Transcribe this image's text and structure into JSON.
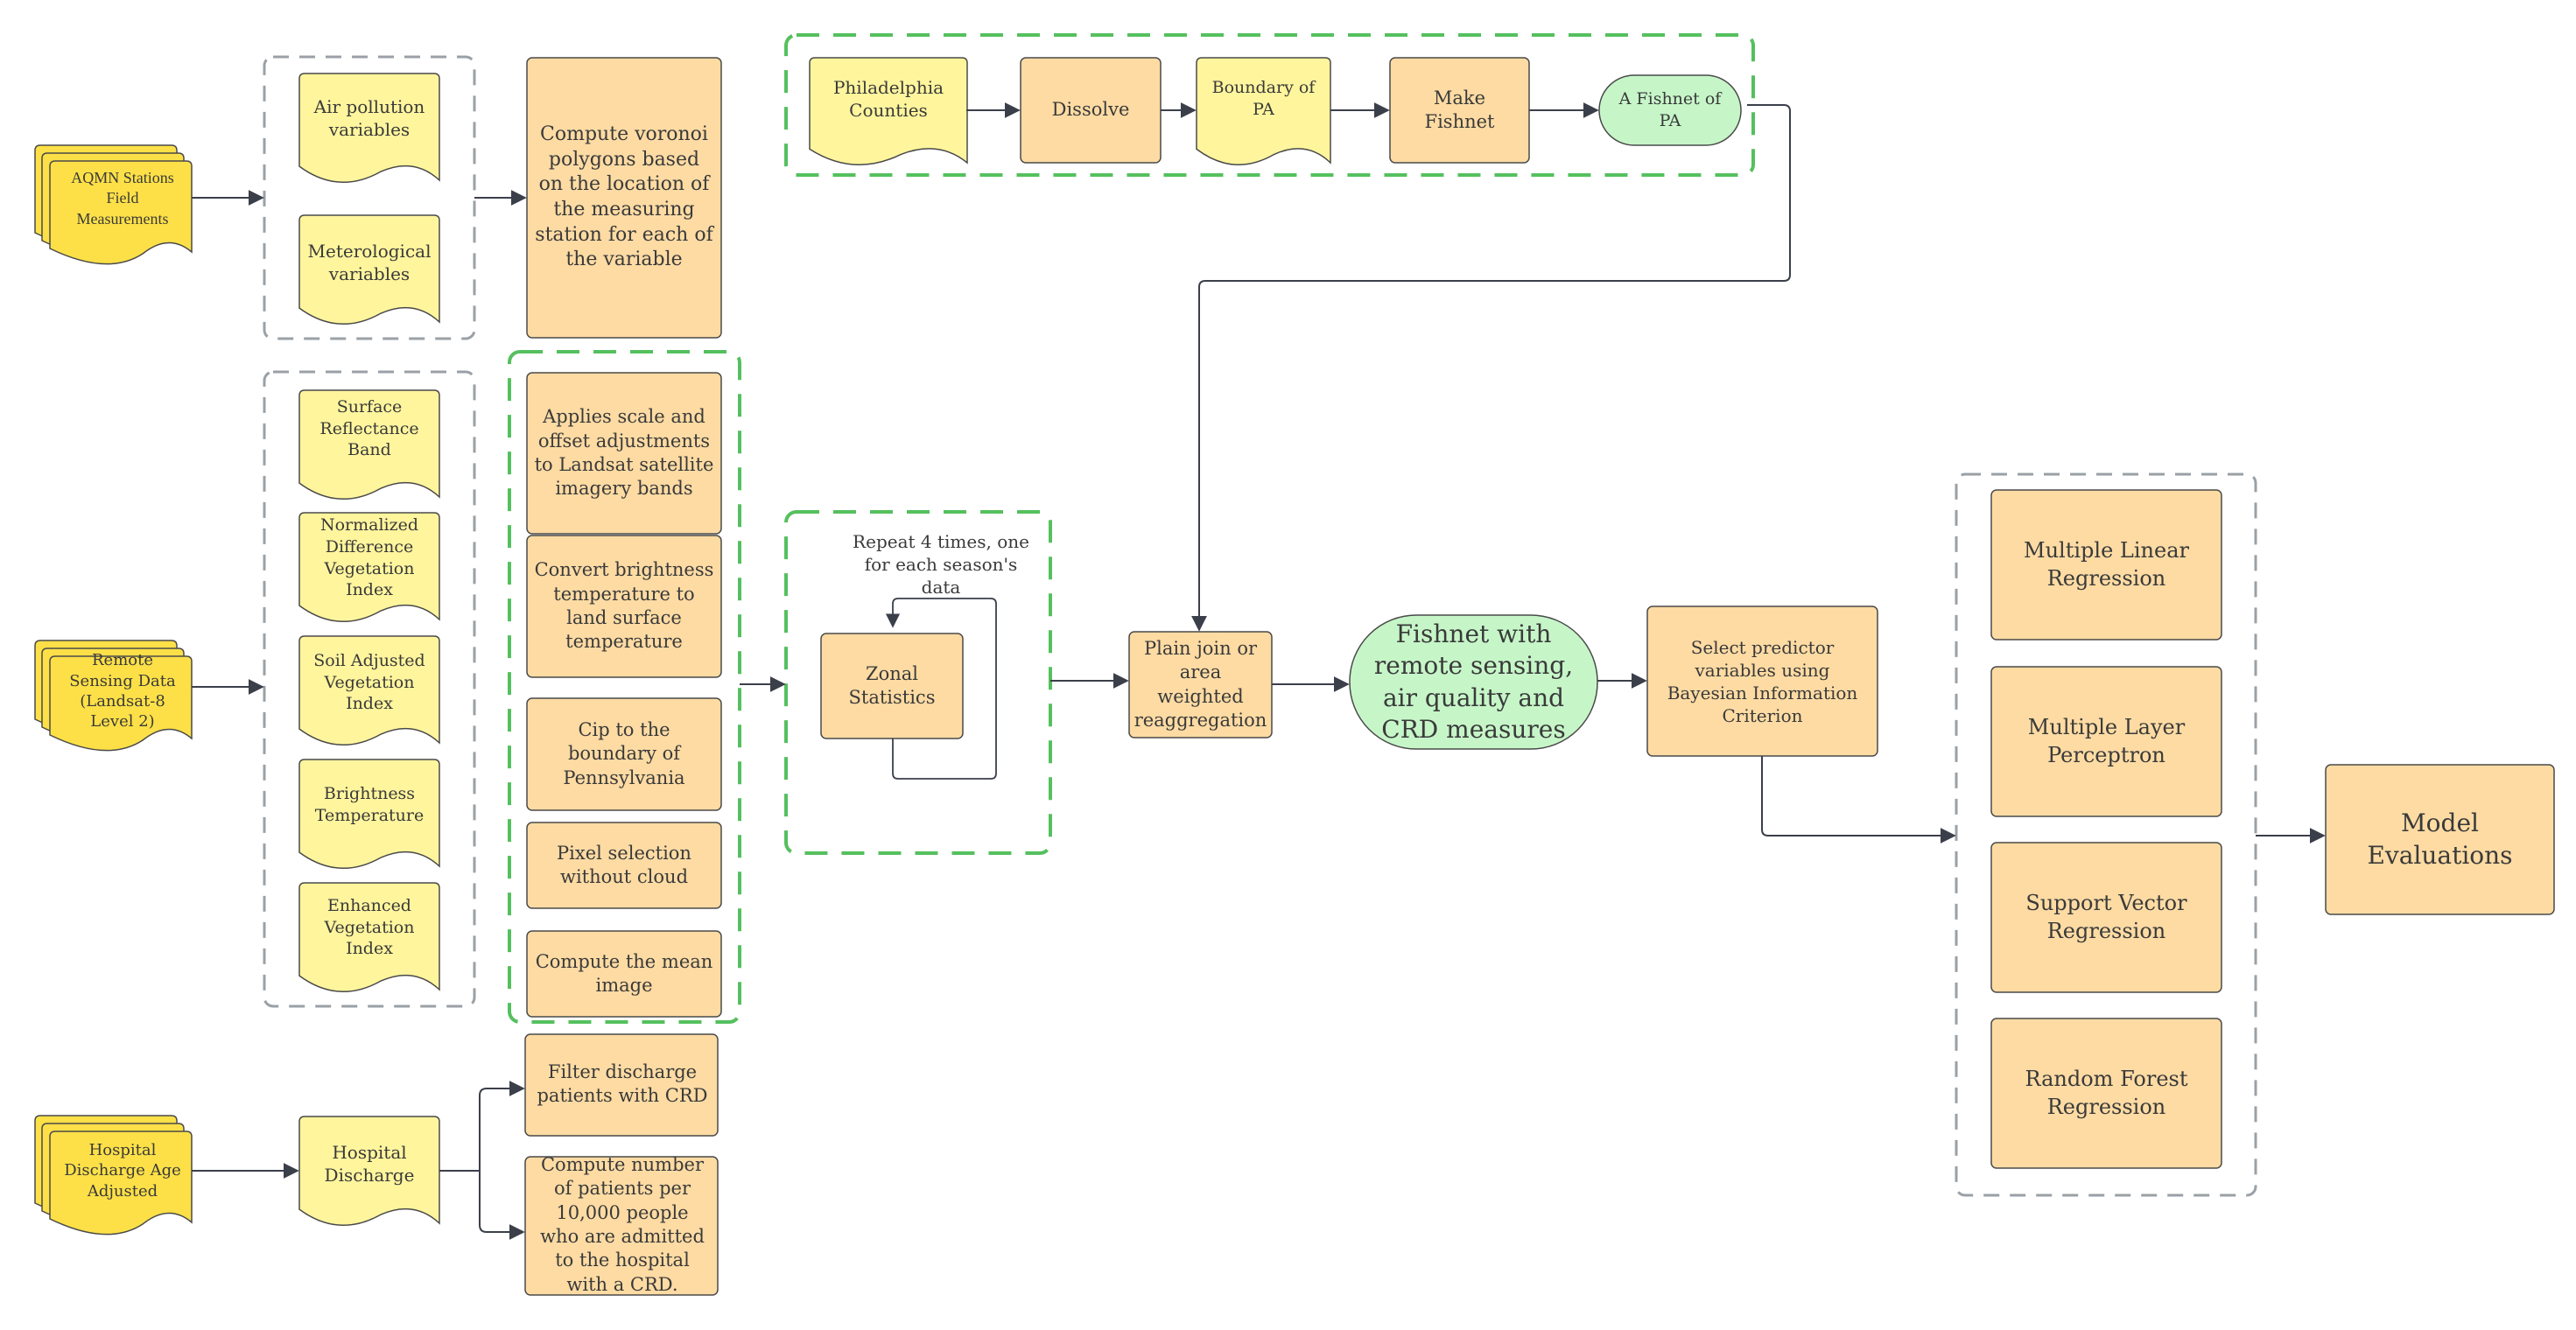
{
  "colors": {
    "source_doc": "#fde047",
    "data_doc": "#fff59d",
    "process": "#fddba3",
    "output": "#c6f6c8",
    "border": "#4a4a4a",
    "group_gray": "#9aa0a6",
    "group_green": "#55c05e",
    "arrow": "#3b3f4a"
  },
  "sources": {
    "aqmn": "AQMN Stations Field Measurements",
    "remote_sensing": "Remote Sensing Data (Landsat-8 Level 2)",
    "hospital": "Hospital Discharge Age Adjusted"
  },
  "air_quality": {
    "variables": [
      "Air pollution variables",
      "Meterological variables"
    ],
    "process": "Compute voronoi polygons based on the location of the measuring station for each of the variable"
  },
  "remote_sensing": {
    "variables": [
      "Surface Reflectance Band",
      "Normalized Difference Vegetation Index",
      "Soil Adjusted Vegetation Index",
      "Brightness Temperature",
      "Enhanced Vegetation Index"
    ],
    "steps": [
      "Applies scale and offset adjustments to Landsat satellite imagery bands",
      "Convert brightness temperature to land surface temperature",
      "Cip to the boundary of Pennsylvania",
      "Pixel selection without cloud",
      "Compute the mean image"
    ]
  },
  "hospital": {
    "data": "Hospital Discharge",
    "steps": [
      "Filter discharge patients with CRD",
      "Compute number of patients per 10,000 people who are admitted to the hospital with a CRD."
    ]
  },
  "fishnet_pipeline": {
    "input": "Philadelphia Counties",
    "dissolve": "Dissolve",
    "boundary": "Boundary of PA",
    "make_fishnet": "Make Fishnet",
    "output": "A Fishnet of PA"
  },
  "zonal": {
    "note": "Repeat 4 times, one for each season's data",
    "process": "Zonal Statistics"
  },
  "join": "Plain join or area weighted reaggregation",
  "fishnet_result": "Fishnet with remote sensing, air quality and CRD measures",
  "select_predictors": "Select predictor variables using Bayesian Information Criterion",
  "models": [
    "Multiple Linear Regression",
    "Multiple Layer Perceptron",
    "Support Vector Regression",
    "Random Forest Regression"
  ],
  "evaluation": "Model Evaluations"
}
